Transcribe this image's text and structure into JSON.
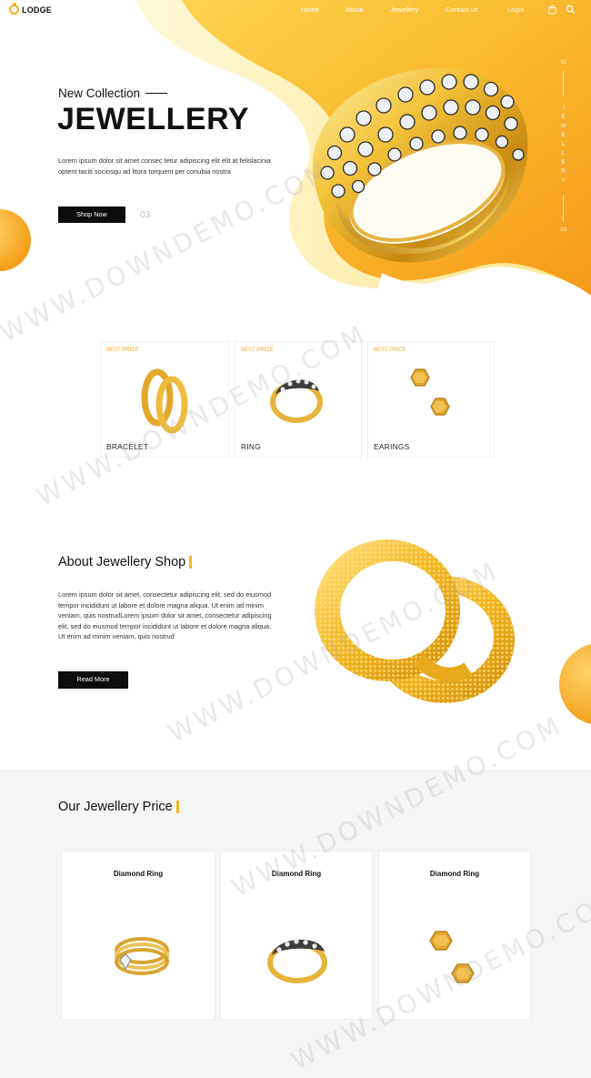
{
  "brand": {
    "name": "LODGE"
  },
  "nav": {
    "items": [
      "Home",
      "About",
      "Jewellery",
      "Contact us",
      "Login"
    ],
    "icons": [
      "bag-icon",
      "search-icon"
    ]
  },
  "hero": {
    "eyebrow": "New Collection",
    "title": "JEWELLERY",
    "text": "Lorem ipsum dolor sit amet consec tetur adipiscing elit elit at felislacinia optent taciti sociosqu ad litora torquent per conubia nostra",
    "button": "Shop Now",
    "slide_number": "03",
    "side_top": "01",
    "side_word": "JEWELLERY",
    "side_bottom": "03"
  },
  "categories": [
    {
      "badge": "BEST PRICE",
      "name": "BRACELET"
    },
    {
      "badge": "BEST PRICE",
      "name": "RING"
    },
    {
      "badge": "BEST PRICE",
      "name": "EARINGS"
    }
  ],
  "about": {
    "title": "About Jewellery Shop",
    "text": "Lorem ipsum dolor sit amet, consectetur adipiscing elit, sed do eiusmod tempor incididunt ut labore et dolore magna aliqua. Ut enim ad minim veniam, quis nostrudLorem ipsum dolor sit amet, consectetur adipiscing elit, sed do eiusmod tempor incididunt ut labore et dolore magna aliqua. Ut enim ad minim veniam, quis nostrud",
    "button": "Read More"
  },
  "prices": {
    "title": "Our Jewellery Price",
    "items": [
      {
        "name": "Diamond Ring"
      },
      {
        "name": "Diamond Ring"
      },
      {
        "name": "Diamond Ring"
      }
    ]
  },
  "watermark": "WWW.DOWNDEMO.COM",
  "colors": {
    "accent": "#f4a623",
    "accent_light": "#fdd66a",
    "dark": "#0c0c0c",
    "section_bg": "#f6f6f6"
  }
}
